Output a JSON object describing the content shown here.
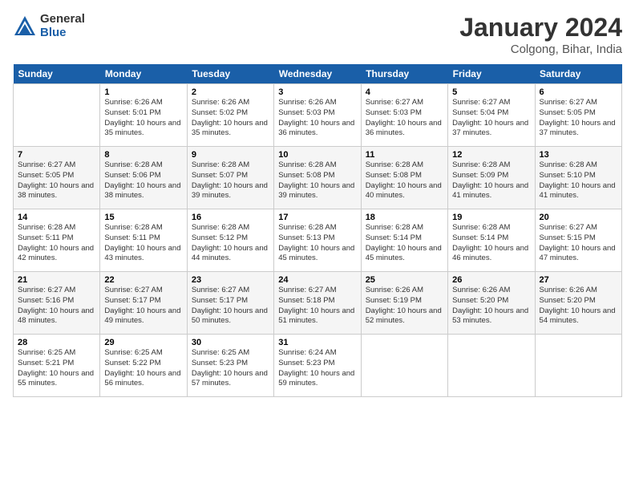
{
  "header": {
    "logo_general": "General",
    "logo_blue": "Blue",
    "month_title": "January 2024",
    "location": "Colgong, Bihar, India"
  },
  "days_of_week": [
    "Sunday",
    "Monday",
    "Tuesday",
    "Wednesday",
    "Thursday",
    "Friday",
    "Saturday"
  ],
  "weeks": [
    [
      {
        "day": "",
        "sunrise": "",
        "sunset": "",
        "daylight": ""
      },
      {
        "day": "1",
        "sunrise": "Sunrise: 6:26 AM",
        "sunset": "Sunset: 5:01 PM",
        "daylight": "Daylight: 10 hours and 35 minutes."
      },
      {
        "day": "2",
        "sunrise": "Sunrise: 6:26 AM",
        "sunset": "Sunset: 5:02 PM",
        "daylight": "Daylight: 10 hours and 35 minutes."
      },
      {
        "day": "3",
        "sunrise": "Sunrise: 6:26 AM",
        "sunset": "Sunset: 5:03 PM",
        "daylight": "Daylight: 10 hours and 36 minutes."
      },
      {
        "day": "4",
        "sunrise": "Sunrise: 6:27 AM",
        "sunset": "Sunset: 5:03 PM",
        "daylight": "Daylight: 10 hours and 36 minutes."
      },
      {
        "day": "5",
        "sunrise": "Sunrise: 6:27 AM",
        "sunset": "Sunset: 5:04 PM",
        "daylight": "Daylight: 10 hours and 37 minutes."
      },
      {
        "day": "6",
        "sunrise": "Sunrise: 6:27 AM",
        "sunset": "Sunset: 5:05 PM",
        "daylight": "Daylight: 10 hours and 37 minutes."
      }
    ],
    [
      {
        "day": "7",
        "sunrise": "Sunrise: 6:27 AM",
        "sunset": "Sunset: 5:05 PM",
        "daylight": "Daylight: 10 hours and 38 minutes."
      },
      {
        "day": "8",
        "sunrise": "Sunrise: 6:28 AM",
        "sunset": "Sunset: 5:06 PM",
        "daylight": "Daylight: 10 hours and 38 minutes."
      },
      {
        "day": "9",
        "sunrise": "Sunrise: 6:28 AM",
        "sunset": "Sunset: 5:07 PM",
        "daylight": "Daylight: 10 hours and 39 minutes."
      },
      {
        "day": "10",
        "sunrise": "Sunrise: 6:28 AM",
        "sunset": "Sunset: 5:08 PM",
        "daylight": "Daylight: 10 hours and 39 minutes."
      },
      {
        "day": "11",
        "sunrise": "Sunrise: 6:28 AM",
        "sunset": "Sunset: 5:08 PM",
        "daylight": "Daylight: 10 hours and 40 minutes."
      },
      {
        "day": "12",
        "sunrise": "Sunrise: 6:28 AM",
        "sunset": "Sunset: 5:09 PM",
        "daylight": "Daylight: 10 hours and 41 minutes."
      },
      {
        "day": "13",
        "sunrise": "Sunrise: 6:28 AM",
        "sunset": "Sunset: 5:10 PM",
        "daylight": "Daylight: 10 hours and 41 minutes."
      }
    ],
    [
      {
        "day": "14",
        "sunrise": "Sunrise: 6:28 AM",
        "sunset": "Sunset: 5:11 PM",
        "daylight": "Daylight: 10 hours and 42 minutes."
      },
      {
        "day": "15",
        "sunrise": "Sunrise: 6:28 AM",
        "sunset": "Sunset: 5:11 PM",
        "daylight": "Daylight: 10 hours and 43 minutes."
      },
      {
        "day": "16",
        "sunrise": "Sunrise: 6:28 AM",
        "sunset": "Sunset: 5:12 PM",
        "daylight": "Daylight: 10 hours and 44 minutes."
      },
      {
        "day": "17",
        "sunrise": "Sunrise: 6:28 AM",
        "sunset": "Sunset: 5:13 PM",
        "daylight": "Daylight: 10 hours and 45 minutes."
      },
      {
        "day": "18",
        "sunrise": "Sunrise: 6:28 AM",
        "sunset": "Sunset: 5:14 PM",
        "daylight": "Daylight: 10 hours and 45 minutes."
      },
      {
        "day": "19",
        "sunrise": "Sunrise: 6:28 AM",
        "sunset": "Sunset: 5:14 PM",
        "daylight": "Daylight: 10 hours and 46 minutes."
      },
      {
        "day": "20",
        "sunrise": "Sunrise: 6:27 AM",
        "sunset": "Sunset: 5:15 PM",
        "daylight": "Daylight: 10 hours and 47 minutes."
      }
    ],
    [
      {
        "day": "21",
        "sunrise": "Sunrise: 6:27 AM",
        "sunset": "Sunset: 5:16 PM",
        "daylight": "Daylight: 10 hours and 48 minutes."
      },
      {
        "day": "22",
        "sunrise": "Sunrise: 6:27 AM",
        "sunset": "Sunset: 5:17 PM",
        "daylight": "Daylight: 10 hours and 49 minutes."
      },
      {
        "day": "23",
        "sunrise": "Sunrise: 6:27 AM",
        "sunset": "Sunset: 5:17 PM",
        "daylight": "Daylight: 10 hours and 50 minutes."
      },
      {
        "day": "24",
        "sunrise": "Sunrise: 6:27 AM",
        "sunset": "Sunset: 5:18 PM",
        "daylight": "Daylight: 10 hours and 51 minutes."
      },
      {
        "day": "25",
        "sunrise": "Sunrise: 6:26 AM",
        "sunset": "Sunset: 5:19 PM",
        "daylight": "Daylight: 10 hours and 52 minutes."
      },
      {
        "day": "26",
        "sunrise": "Sunrise: 6:26 AM",
        "sunset": "Sunset: 5:20 PM",
        "daylight": "Daylight: 10 hours and 53 minutes."
      },
      {
        "day": "27",
        "sunrise": "Sunrise: 6:26 AM",
        "sunset": "Sunset: 5:20 PM",
        "daylight": "Daylight: 10 hours and 54 minutes."
      }
    ],
    [
      {
        "day": "28",
        "sunrise": "Sunrise: 6:25 AM",
        "sunset": "Sunset: 5:21 PM",
        "daylight": "Daylight: 10 hours and 55 minutes."
      },
      {
        "day": "29",
        "sunrise": "Sunrise: 6:25 AM",
        "sunset": "Sunset: 5:22 PM",
        "daylight": "Daylight: 10 hours and 56 minutes."
      },
      {
        "day": "30",
        "sunrise": "Sunrise: 6:25 AM",
        "sunset": "Sunset: 5:23 PM",
        "daylight": "Daylight: 10 hours and 57 minutes."
      },
      {
        "day": "31",
        "sunrise": "Sunrise: 6:24 AM",
        "sunset": "Sunset: 5:23 PM",
        "daylight": "Daylight: 10 hours and 59 minutes."
      },
      {
        "day": "",
        "sunrise": "",
        "sunset": "",
        "daylight": ""
      },
      {
        "day": "",
        "sunrise": "",
        "sunset": "",
        "daylight": ""
      },
      {
        "day": "",
        "sunrise": "",
        "sunset": "",
        "daylight": ""
      }
    ]
  ]
}
